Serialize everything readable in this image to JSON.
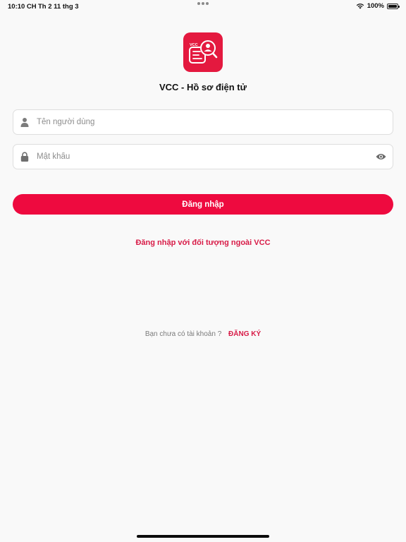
{
  "status_bar": {
    "time": "10:10 CH",
    "date": "Th 2 11 thg 3",
    "battery": "100%"
  },
  "app": {
    "logo_text": "VCC",
    "title": "VCC - Hồ sơ điện tử"
  },
  "form": {
    "username": {
      "placeholder": "Tên người dùng",
      "value": "",
      "icon": "person-icon"
    },
    "password": {
      "placeholder": "Mật khẩu",
      "value": "",
      "icon": "lock-icon",
      "toggle_icon": "eye-icon"
    },
    "login_label": "Đăng nhập"
  },
  "external_login_label": "Đăng nhập với đối tượng ngoài VCC",
  "signup": {
    "question": "Bạn chưa có tài khoản ?",
    "link_label": "ĐĂNG KÝ"
  },
  "colors": {
    "brand_red": "#ee0a3f",
    "logo_red": "#e4193f",
    "link_red": "#d81b47",
    "background": "#f9f9f9"
  }
}
